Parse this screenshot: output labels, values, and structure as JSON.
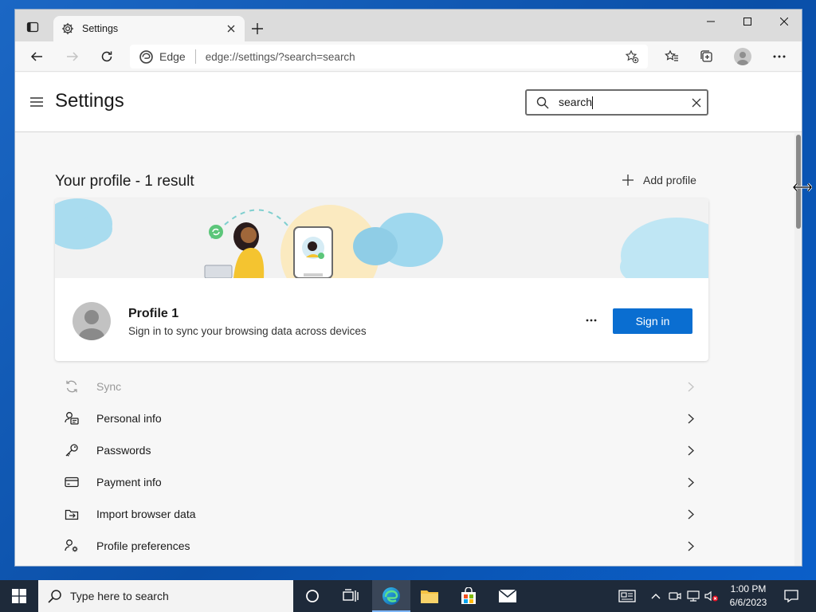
{
  "browser": {
    "tab_title": "Settings",
    "brand_label": "Edge",
    "url": "edge://settings/?search=search"
  },
  "settings_page": {
    "title": "Settings",
    "search_value": "search",
    "section_title": "Your profile - 1 result",
    "add_profile_label": "Add profile",
    "profile": {
      "name": "Profile 1",
      "subtitle": "Sign in to sync your browsing data across devices",
      "sign_in_label": "Sign in"
    },
    "rows": [
      {
        "label": "Sync",
        "icon": "sync-icon",
        "disabled": true
      },
      {
        "label": "Personal info",
        "icon": "personal-info-icon",
        "disabled": false
      },
      {
        "label": "Passwords",
        "icon": "key-icon",
        "disabled": false
      },
      {
        "label": "Payment info",
        "icon": "credit-card-icon",
        "disabled": false
      },
      {
        "label": "Import browser data",
        "icon": "import-icon",
        "disabled": false
      },
      {
        "label": "Profile preferences",
        "icon": "profile-preferences-icon",
        "disabled": false
      }
    ]
  },
  "taskbar": {
    "search_placeholder": "Type here to search",
    "time": "1:00 PM",
    "date": "6/6/2023"
  },
  "colors": {
    "accent": "#0a6ed1",
    "desktop": "#0b5fc9",
    "taskbar": "#1e2a3a"
  }
}
